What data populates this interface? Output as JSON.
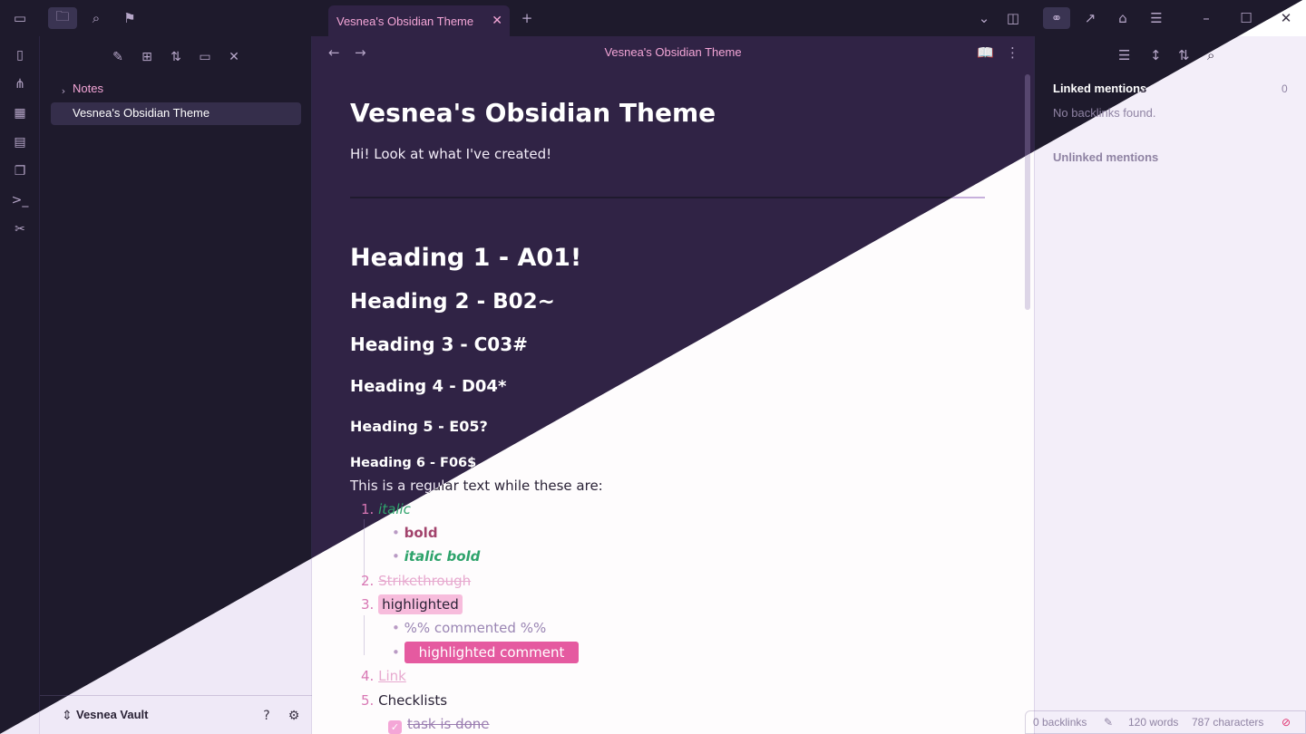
{
  "titlebar": {
    "tab_title": "Vesnea's Obsidian Theme",
    "tab_close": "✕",
    "new_tab": "+",
    "icons": {
      "sidebar_toggle": "sidebar-left-icon",
      "files": "folder-icon",
      "search": "search-icon",
      "bookmarks": "bookmark-icon",
      "tab_list": "chevron-down-icon",
      "right_sidebar": "sidebar-right-icon",
      "backlinks": "backlinks-icon",
      "outgoing": "outgoing-links-icon",
      "tags": "tag-icon",
      "outline": "outline-icon",
      "minimize": "minimize-icon",
      "maximize": "maximize-icon",
      "close": "close-icon"
    }
  },
  "ribbon": {
    "icons": [
      "open-note-icon",
      "graph-icon",
      "canvas-icon",
      "calendar-icon",
      "templates-icon",
      "terminal-icon",
      "theme-icon"
    ]
  },
  "sidebar": {
    "toolbar_icons": [
      "new-note-icon",
      "new-folder-icon",
      "sort-icon",
      "auto-reveal-icon",
      "collapse-all-icon"
    ],
    "tree": {
      "folder": "Notes",
      "active_file": "Vesnea's Obsidian Theme"
    },
    "vault": {
      "name": "Vesnea Vault",
      "help_icon": "help-icon",
      "settings_icon": "gear-icon"
    }
  },
  "editor": {
    "view_title": "Vesnea's Obsidian Theme",
    "title": "Vesnea's Obsidian Theme",
    "intro": "Hi! Look at what I've created!",
    "headings": {
      "h1": "Heading 1 - A01!",
      "h2": "Heading 2 - B02~",
      "h3": "Heading 3 - C03#",
      "h4": "Heading 4 - D04*",
      "h5": "Heading 5 - E05?",
      "h6": "Heading 6 - F06$"
    },
    "regular": "This is a regular text while these are:",
    "list": {
      "n1": "1.",
      "italic": "italic",
      "bold": "bold",
      "italic_bold": "italic bold",
      "n2": "2.",
      "strike": "Strikethrough",
      "n3": "3.",
      "highlighted": "highlighted",
      "comment": "%% commented %%",
      "highlighted_comment": "highlighted comment",
      "n4": "4.",
      "link": "Link",
      "n5": "5.",
      "checklists": "Checklists",
      "task_done": "task is done",
      "bullet": "•"
    }
  },
  "right_panel": {
    "linked_mentions": "Linked mentions",
    "linked_count": "0",
    "no_backlinks": "No backlinks found.",
    "unlinked_mentions": "Unlinked mentions"
  },
  "status": {
    "backlinks": "0 backlinks",
    "words": "120 words",
    "characters": "787 characters"
  },
  "colors": {
    "dark_bg": "#1e1a2c",
    "dark_editor": "#302345",
    "light_bg": "#fcfafd",
    "accent_pink": "#e55aa0",
    "green": "#2ea36b"
  }
}
